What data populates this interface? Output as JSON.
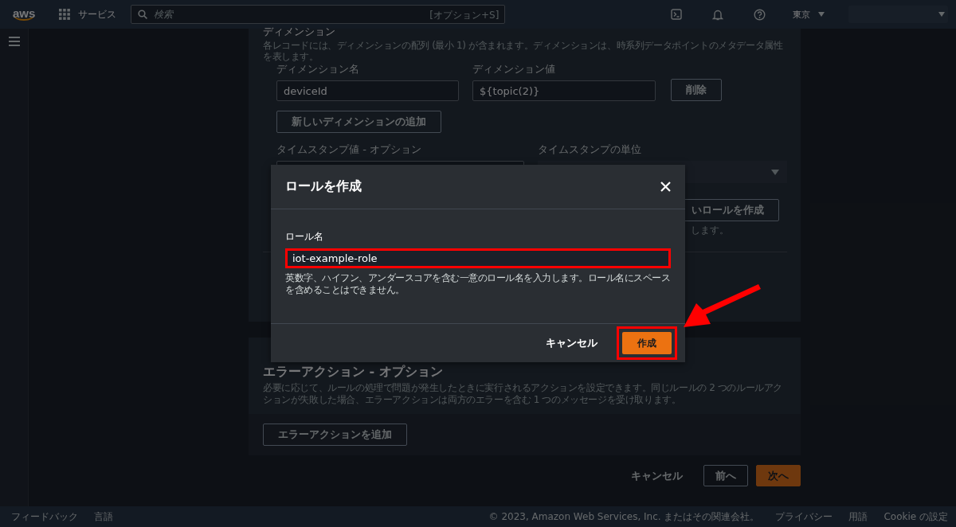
{
  "header": {
    "logo": "aws",
    "services": "サービス",
    "search": {
      "placeholder": "検索",
      "shortcut": "[オプション+S]"
    },
    "region": "東京"
  },
  "dimensions": {
    "title": "ディメンション",
    "description": "各レコードには、ディメンションの配列 (最小 1) が含まれます。ディメンションは、時系列データポイントのメタデータ属性を表します。",
    "name_label": "ディメンション名",
    "name_value": "deviceId",
    "value_label": "ディメンション値",
    "value_value": "${topic(2)}",
    "delete_button": "削除",
    "add_button": "新しいディメンションの追加"
  },
  "timestamp": {
    "value_label": "タイムスタンプ値 - オプション",
    "unit_label": "タイムスタンプの単位"
  },
  "role": {
    "button": "いロールを作成",
    "help": "します。"
  },
  "error_action": {
    "title": "エラーアクション - オプション",
    "description": "必要に応じて、ルールの処理で問題が発生したときに実行されるアクションを設定できます。同じルールの 2 つのルールアクションが失敗した場合、エラーアクションは両方のエラーを含む 1 つのメッセージを受け取ります。",
    "add_button": "エラーアクションを追加"
  },
  "page_buttons": {
    "cancel": "キャンセル",
    "previous": "前へ",
    "next": "次へ"
  },
  "footer": {
    "feedback": "フィードバック",
    "language": "言語",
    "copyright": "© 2023, Amazon Web Services, Inc. またはその関連会社。",
    "links": [
      "プライバシー",
      "用語",
      "Cookie の設定"
    ]
  },
  "modal": {
    "title": "ロールを作成",
    "field_label": "ロール名",
    "field_value": "iot-example-role",
    "field_highlighted": true,
    "help": "英数字、ハイフン、アンダースコアを含む一意のロール名を入力します。ロール名にスペースを含めることはできません。",
    "cancel": "キャンセル",
    "create": {
      "label": "作成",
      "highlighted": true
    }
  }
}
